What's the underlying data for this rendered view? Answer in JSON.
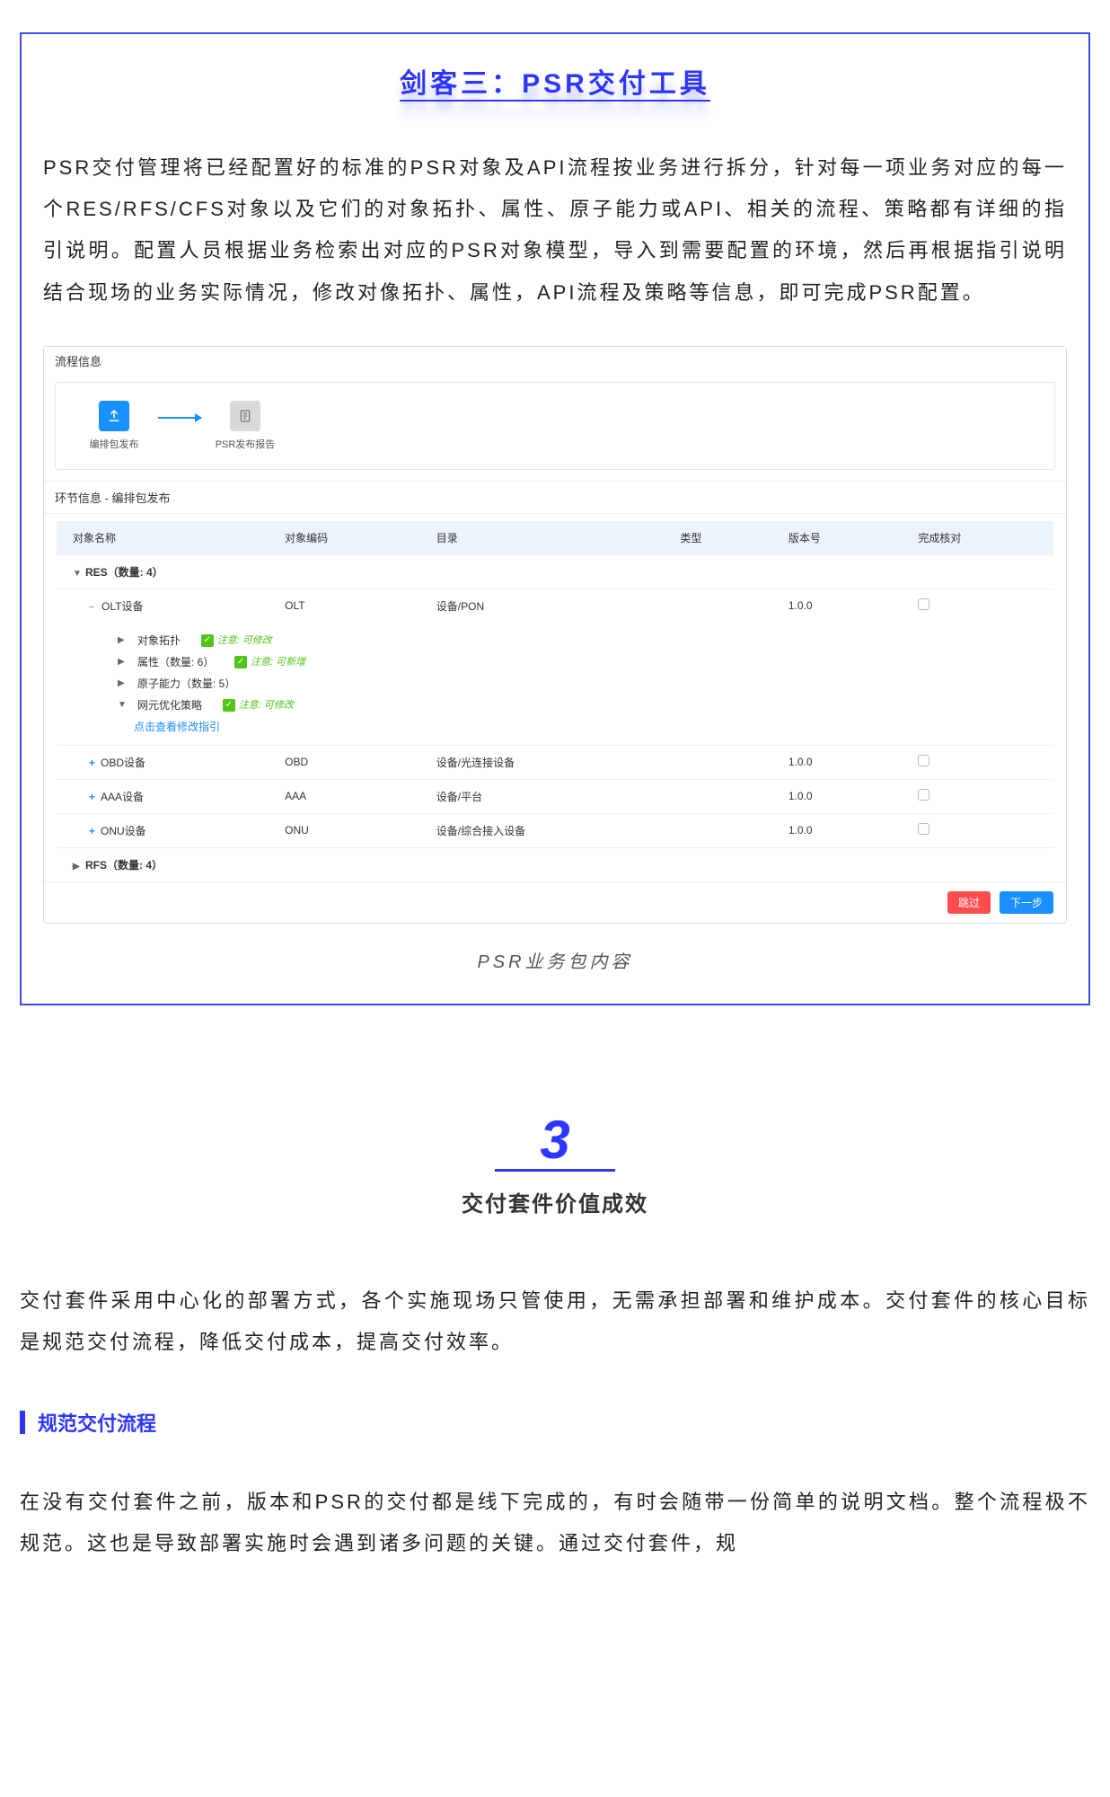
{
  "card": {
    "title": "剑客三：PSR交付工具",
    "paragraph": "PSR交付管理将已经配置好的标准的PSR对象及API流程按业务进行拆分，针对每一项业务对应的每一个RES/RFS/CFS对象以及它们的对象拓扑、属性、原子能力或API、相关的流程、策略都有详细的指引说明。配置人员根据业务检索出对应的PSR对象模型，导入到需要配置的环境，然后再根据指引说明结合现场的业务实际情况，修改对像拓扑、属性，API流程及策略等信息，即可完成PSR配置。"
  },
  "shot": {
    "section1_title": "流程信息",
    "flow_node1": "编排包发布",
    "flow_node2": "PSR发布报告",
    "subhead": "环节信息 - 编排包发布",
    "columns": [
      "对象名称",
      "对象编码",
      "目录",
      "类型",
      "版本号",
      "完成核对"
    ],
    "res_group": "RES（数量: 4）",
    "rows": [
      {
        "name": "OLT设备",
        "code": "OLT",
        "dir": "设备/PON",
        "type": "",
        "ver": "1.0.0",
        "expand": "minus"
      },
      {
        "name": "OBD设备",
        "code": "OBD",
        "dir": "设备/光连接设备",
        "type": "",
        "ver": "1.0.0",
        "expand": "plus"
      },
      {
        "name": "AAA设备",
        "code": "AAA",
        "dir": "设备/平台",
        "type": "",
        "ver": "1.0.0",
        "expand": "plus"
      },
      {
        "name": "ONU设备",
        "code": "ONU",
        "dir": "设备/综合接入设备",
        "type": "",
        "ver": "1.0.0",
        "expand": "plus"
      }
    ],
    "subitems": {
      "topo": "对象拓扑",
      "topo_hint": "注意: 可修改",
      "attr": "属性（数量: 6）",
      "attr_hint": "注意: 可新增",
      "atom": "原子能力（数量: 5）",
      "policy": "网元优化策略",
      "policy_hint": "注意: 可修改",
      "link": "点击查看修改指引"
    },
    "rfs_group": "RFS（数量: 4）",
    "btn_skip": "跳过",
    "btn_next": "下一步"
  },
  "caption": "PSR业务包内容",
  "section3": {
    "num": "3",
    "title": "交付套件价值成效",
    "para": "交付套件采用中心化的部署方式，各个实施现场只管使用，无需承担部署和维护成本。交付套件的核心目标是规范交付流程，降低交付成本，提高交付效率。",
    "subheading": "规范交付流程",
    "para2": "在没有交付套件之前，版本和PSR的交付都是线下完成的，有时会随带一份简单的说明文档。整个流程极不规范。这也是导致部署实施时会遇到诸多问题的关键。通过交付套件，规"
  }
}
